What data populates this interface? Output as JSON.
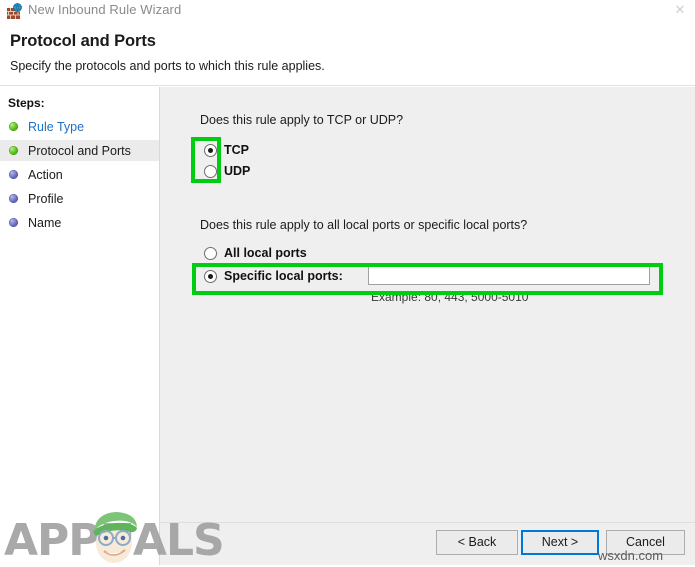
{
  "window": {
    "title": "New Inbound Rule Wizard",
    "icon": "firewall-globe-icon",
    "close_label": "✕"
  },
  "header": {
    "title": "Protocol and Ports",
    "subtitle": "Specify the protocols and ports to which this rule applies."
  },
  "sidebar": {
    "heading": "Steps:",
    "items": [
      {
        "label": "Rule Type",
        "state": "done",
        "current": false,
        "link": true
      },
      {
        "label": "Protocol and Ports",
        "state": "done",
        "current": true,
        "link": false
      },
      {
        "label": "Action",
        "state": "pending",
        "current": false,
        "link": false
      },
      {
        "label": "Profile",
        "state": "pending",
        "current": false,
        "link": false
      },
      {
        "label": "Name",
        "state": "pending",
        "current": false,
        "link": false
      }
    ]
  },
  "main": {
    "protocol_question": "Does this rule apply to TCP or UDP?",
    "protocol_options": [
      {
        "label": "TCP",
        "selected": true
      },
      {
        "label": "UDP",
        "selected": false
      }
    ],
    "ports_question": "Does this rule apply to all local ports or specific local ports?",
    "ports_options": [
      {
        "label": "All local ports",
        "selected": false
      },
      {
        "label": "Specific local ports:",
        "selected": true
      }
    ],
    "ports_input_value": "",
    "ports_input_placeholder": "",
    "ports_example": "Example: 80, 443, 5000-5010"
  },
  "footer": {
    "back_label": "< Back",
    "next_label": "Next >",
    "cancel_label": "Cancel"
  },
  "annotations": {
    "color": "#00cc11",
    "boxes": [
      {
        "target": "protocol-radio-group"
      },
      {
        "target": "specific-local-ports-row"
      }
    ]
  },
  "watermarks": {
    "brand": "APPUALS",
    "source": "wsxdn.com"
  }
}
